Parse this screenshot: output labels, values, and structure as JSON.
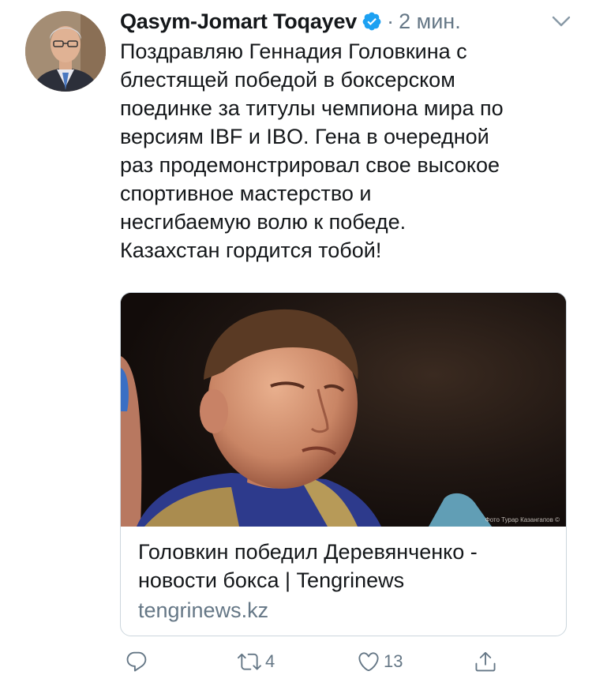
{
  "tweet": {
    "author_name": "Qasym-Jomart Toqayev",
    "separator": "·",
    "time": "2 мин.",
    "text": "Поздравляю Геннадия Головкина с\nблестящей победой в боксерском\nпоединке за титулы чемпиона мира по\nверсиям IBF и IBO. Гена в очередной\nраз продемонстрировал свое высокое\nспортивное мастерство и\nнесгибаемую волю к победе.\nКазахстан гордится тобой!"
  },
  "card": {
    "photo_credit": "Фото Турар Казангапов ©",
    "title": "Головкин победил Деревянченко -\nновости бокса | Tengrinews",
    "domain": "tengrinews.kz"
  },
  "actions": {
    "reply_icon": "reply-icon",
    "retweet_icon": "retweet-icon",
    "retweet_count": "4",
    "like_icon": "heart-icon",
    "like_count": "13",
    "share_icon": "share-icon"
  },
  "colors": {
    "text": "#14171a",
    "secondary": "#657786",
    "verified": "#1da1f2",
    "border": "#ccd6dd"
  }
}
